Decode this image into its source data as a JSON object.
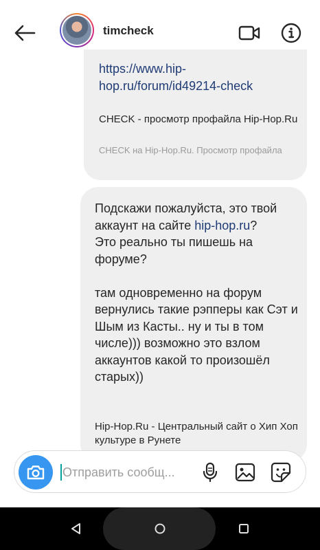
{
  "header": {
    "username": "timcheck",
    "icons": {
      "back": "arrow-left-icon",
      "video": "video-camera-icon",
      "info": "info-icon"
    }
  },
  "messages": [
    {
      "link_url": "https://www.hip-hop.ru/forum/id49214-check",
      "preview_title": "CHECK - просмотр профайла Hip-Hop.Ru",
      "preview_description": "CHECK на Hip-Hop.Ru. Просмотр профайла"
    },
    {
      "line_1": "Подскажи пожалуйста, это твой аккаунт на сайте ",
      "link_text": "hip-hop.ru",
      "line_1_end": "?",
      "line_2": "Это реально ты пишешь на форуме?",
      "paragraph_2": "там одновременно на форум вернулись такие рэпперы как Сэт и Шым из Касты.. ну и ты в том числе)))  возможно это взлом аккаунтов какой то произошёл старых))",
      "footer_text": "Hip-Hop.Ru - Центральный сайт о Хип Хоп культуре в Рунете"
    }
  ],
  "composer": {
    "placeholder": "Отправить сообщ...",
    "icons": {
      "camera": "camera-icon",
      "mic": "microphone-icon",
      "gallery": "image-gallery-icon",
      "sticker": "sticker-icon"
    }
  },
  "colors": {
    "accent": "#3797f0",
    "link": "#1f3b75",
    "bubble": "#efefef",
    "caret": "#00a19a"
  },
  "navbar": {
    "icons": {
      "back": "nav-back-icon",
      "home": "nav-home-icon",
      "recents": "nav-recents-icon"
    }
  }
}
